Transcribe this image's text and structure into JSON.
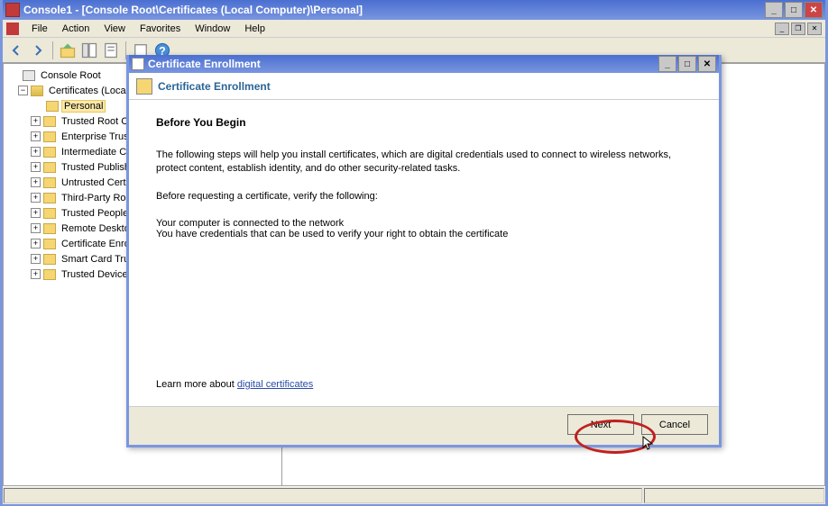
{
  "window": {
    "title": "Console1 - [Console Root\\Certificates (Local Computer)\\Personal]"
  },
  "menu": {
    "file": "File",
    "action": "Action",
    "view": "View",
    "favorites": "Favorites",
    "window": "Window",
    "help": "Help"
  },
  "tree": {
    "root": "Console Root",
    "certs": "Certificates (Local C",
    "items": [
      "Personal",
      "Trusted Root C",
      "Enterprise Trus",
      "Intermediate C",
      "Trusted Publish",
      "Untrusted Cert",
      "Third-Party Ro",
      "Trusted People",
      "Remote Deskto",
      "Certificate Enro",
      "Smart Card Tru",
      "Trusted Device"
    ]
  },
  "dialog": {
    "title": "Certificate Enrollment",
    "header": "Certificate Enrollment",
    "heading": "Before You Begin",
    "para1": "The following steps will help you install certificates, which are digital credentials used to connect to wireless networks, protect content, establish identity, and do other security-related tasks.",
    "para2": "Before requesting a certificate, verify the following:",
    "item1": "Your computer is connected to the network",
    "item2": "You have credentials that can be used to verify your right to obtain the certificate",
    "learn_prefix": "Learn more about ",
    "learn_link": "digital certificates",
    "next": "Next",
    "cancel": "Cancel"
  }
}
